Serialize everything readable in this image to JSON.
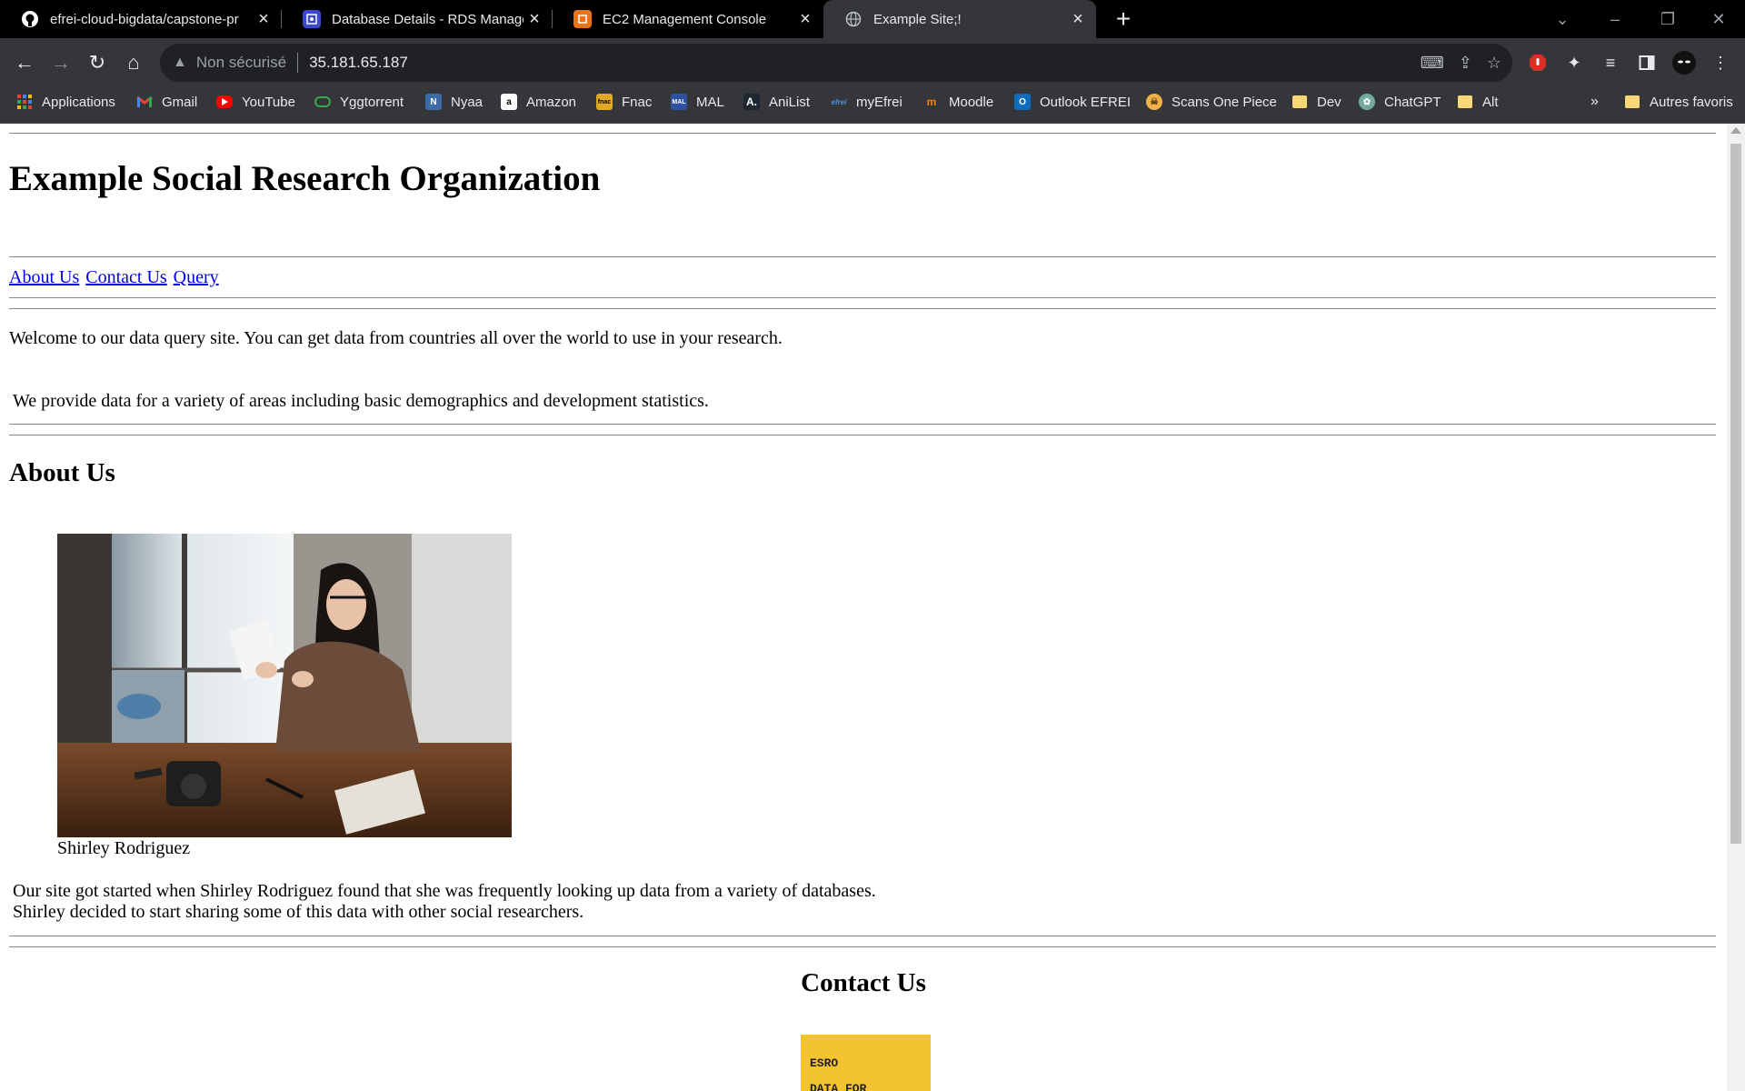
{
  "tabs": [
    {
      "title": "efrei-cloud-bigdata/capstone-pr",
      "icon": "github-icon"
    },
    {
      "title": "Database Details - RDS Managem",
      "icon": "rds-icon"
    },
    {
      "title": "EC2 Management Console",
      "icon": "ec2-icon"
    },
    {
      "title": "Example Site;!",
      "icon": "globe-icon"
    }
  ],
  "toolbar": {
    "security_label": "Non sécurisé",
    "url": "35.181.65.187"
  },
  "bookmarks": [
    {
      "label": "Applications",
      "icon": "apps-grid-icon"
    },
    {
      "label": "Gmail",
      "icon": "gmail-icon"
    },
    {
      "label": "YouTube",
      "icon": "youtube-icon"
    },
    {
      "label": "Yggtorrent",
      "icon": "yggtorrent-icon"
    },
    {
      "label": "Nyaa",
      "icon": "nyaa-icon"
    },
    {
      "label": "Amazon",
      "icon": "amazon-icon"
    },
    {
      "label": "Fnac",
      "icon": "fnac-icon"
    },
    {
      "label": "MAL",
      "icon": "mal-icon"
    },
    {
      "label": "AniList",
      "icon": "anilist-icon"
    },
    {
      "label": "myEfrei",
      "icon": "efrei-icon"
    },
    {
      "label": "Moodle",
      "icon": "moodle-icon"
    },
    {
      "label": "Outlook EFREI",
      "icon": "outlook-icon"
    },
    {
      "label": "Scans One Piece",
      "icon": "one-piece-icon"
    },
    {
      "label": "Dev",
      "icon": "folder-icon"
    },
    {
      "label": "ChatGPT",
      "icon": "chatgpt-icon"
    },
    {
      "label": "Alt",
      "icon": "folder-icon"
    }
  ],
  "bookmarks_overflow": "»",
  "other_bookmarks": "Autres favoris",
  "page": {
    "title": "Example Social Research Organization",
    "nav": [
      "About Us",
      "Contact Us",
      "Query"
    ],
    "welcome": "Welcome to our data query site. You can get data from countries all over the world to use in your research.",
    "provide": "We provide data for a variety of areas including basic demographics and development statistics.",
    "about_heading": "About Us",
    "photo_caption": "Shirley Rodriguez",
    "about_line1": "Our site got started when Shirley Rodriguez found that she was frequently looking up data from a variety of databases.",
    "about_line2": "Shirley decided to start sharing some of this data with other social researchers.",
    "contact_heading": "Contact Us",
    "logo_line1": "ESRO",
    "logo_line2": "DATA FOR"
  }
}
